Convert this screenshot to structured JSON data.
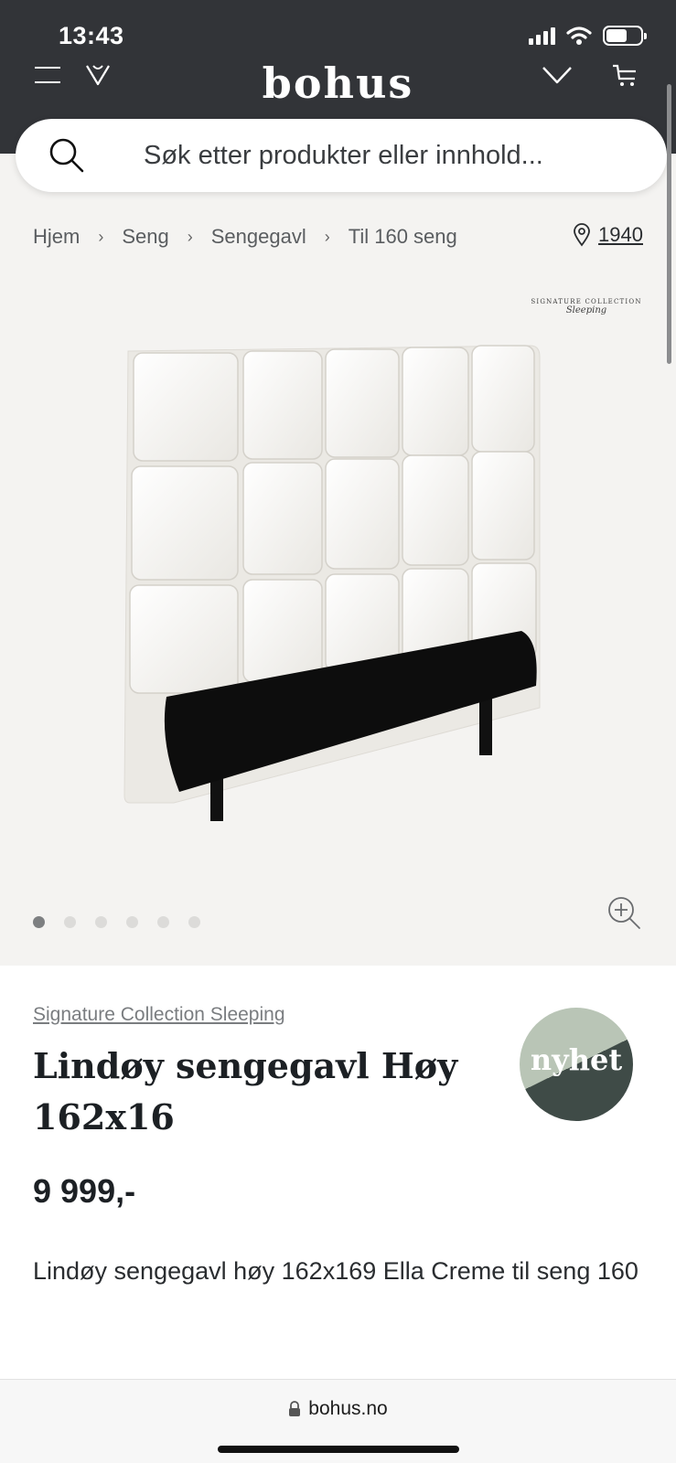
{
  "status_bar": {
    "time": "13:43",
    "icons": [
      "signal-icon",
      "wifi-icon",
      "battery-icon"
    ]
  },
  "header": {
    "logo": "bohus",
    "icons": [
      "menu-icon",
      "heart-icon",
      "chevron-down-icon",
      "cart-icon"
    ],
    "background": "#323438"
  },
  "search": {
    "placeholder": "Søk etter produkter eller innhold..."
  },
  "breadcrumb": {
    "items": [
      "Hjem",
      "Seng",
      "Sengegavl",
      "Til 160 seng"
    ]
  },
  "store": {
    "label": "1940",
    "icon": "location-pin-icon"
  },
  "gallery": {
    "brand_logo_line1": "SIGNATURE COLLECTION",
    "brand_logo_line2": "Sleeping",
    "image_count": 6,
    "active_index": 0,
    "zoom_icon": "zoom-in-icon"
  },
  "product": {
    "brand": "Signature Collection Sleeping",
    "title": "Lindøy sengegavl Høy 162x16",
    "badge": "nyhet",
    "price": "9 999,-",
    "description": "Lindøy sengegavl høy 162x169 Ella Creme til seng 160"
  },
  "browser": {
    "url": "bohus.no",
    "lock_icon": "lock-icon"
  },
  "colors": {
    "badge_light": "#b9c5b6",
    "badge_dark": "#3f4b47",
    "background": "#f4f3f1"
  }
}
